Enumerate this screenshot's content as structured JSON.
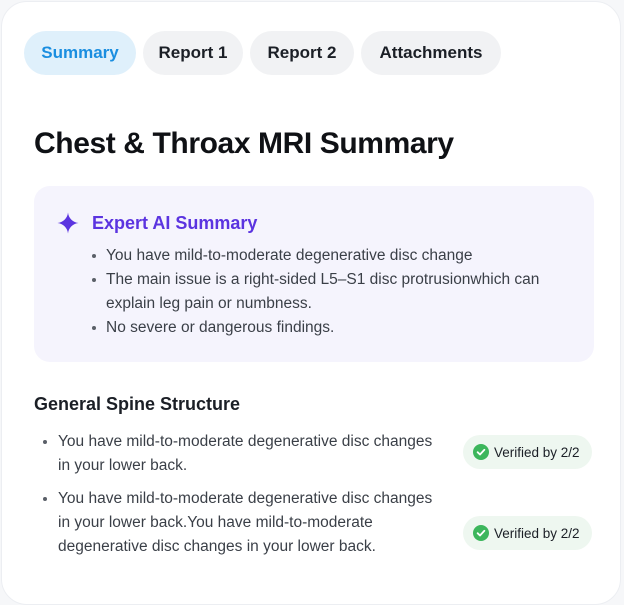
{
  "tabs": [
    {
      "label": "Summary",
      "active": true
    },
    {
      "label": "Report 1",
      "active": false
    },
    {
      "label": "Report 2",
      "active": false
    },
    {
      "label": "Attachments",
      "active": false
    }
  ],
  "page_title": "Chest & Throax MRI Summary",
  "ai_summary": {
    "icon": "sparkle-icon",
    "title": "Expert AI Summary",
    "items": [
      "You have mild-to-moderate degenerative disc change",
      "The main issue is a right-sided L5–S1 disc protrusionwhich can explain leg pain or numbness.",
      "No severe or dangerous findings."
    ]
  },
  "general_spine": {
    "title": "General Spine Structure",
    "items": [
      {
        "text": "You have mild-to-moderate degenerative disc changes in your lower back.",
        "badge": "Verified by 2/2"
      },
      {
        "text": "You have mild-to-moderate degenerative disc changes in your lower back.You have mild-to-moderate degenerative disc changes in your lower back.",
        "badge": "Verified by 2/2"
      }
    ]
  },
  "colors": {
    "accent_blue": "#1a8ee0",
    "ai_purple": "#5b34e0",
    "verified_green": "#3cb65c"
  }
}
